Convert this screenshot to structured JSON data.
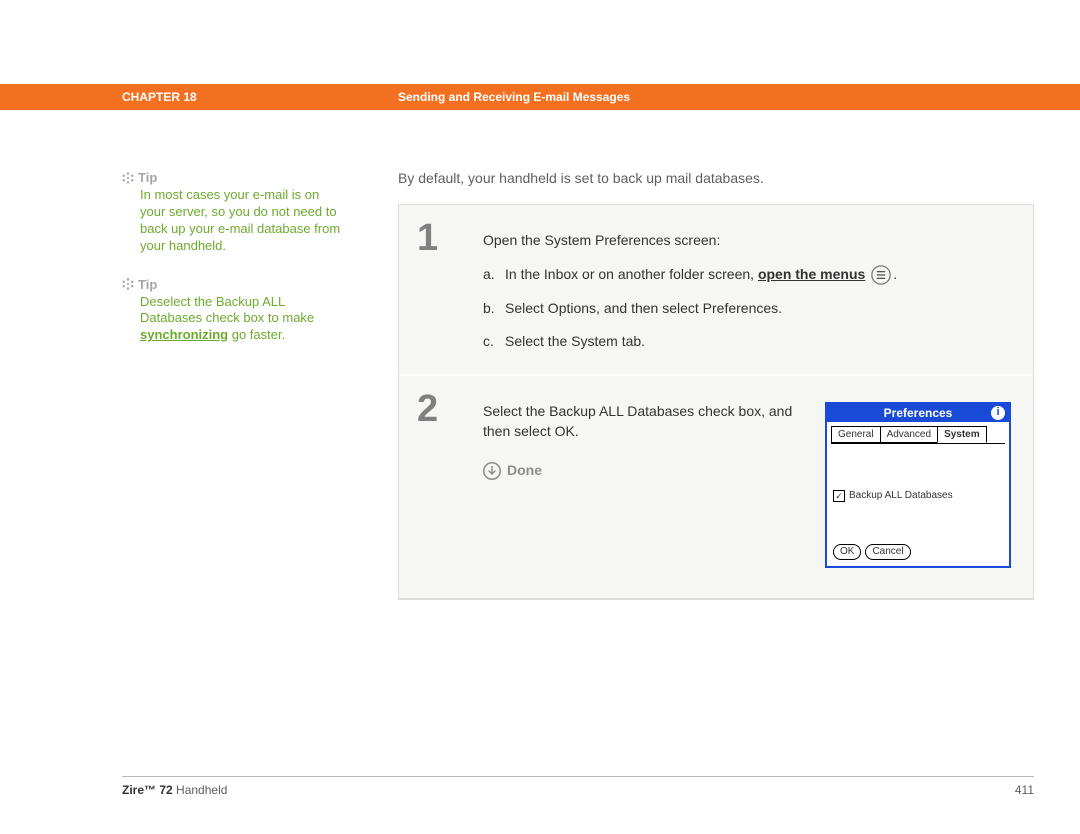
{
  "chapter": {
    "label": "CHAPTER 18",
    "title": "Sending and Receiving E-mail Messages"
  },
  "tips": [
    {
      "heading": "Tip",
      "body_pre": "In most cases your e-mail is on your server, so you do not need to back up your e-mail database from your handheld.",
      "link": "",
      "body_post": ""
    },
    {
      "heading": "Tip",
      "body_pre": "Deselect the Backup ALL Databases check box to make ",
      "link": "synchronizing",
      "body_post": " go faster."
    }
  ],
  "lead": "By default, your handheld is set to back up mail databases.",
  "steps": [
    {
      "num": "1",
      "title": "Open the System Preferences screen:",
      "subs": [
        {
          "idx": "a.",
          "pre": "In the Inbox or on another folder screen, ",
          "link": "open the menus",
          "post": " ",
          "icon": "menu-icon",
          "tail": "."
        },
        {
          "idx": "b.",
          "pre": "Select Options, and then select Preferences.",
          "link": "",
          "post": "",
          "icon": "",
          "tail": ""
        },
        {
          "idx": "c.",
          "pre": "Select the System tab.",
          "link": "",
          "post": "",
          "icon": "",
          "tail": ""
        }
      ]
    },
    {
      "num": "2",
      "text": "Select the Backup ALL Databases check box, and then select OK.",
      "done": "Done"
    }
  ],
  "device": {
    "title": "Preferences",
    "tabs": {
      "general": "General",
      "advanced": "Advanced",
      "system": "System"
    },
    "checkbox_label": "Backup ALL Databases",
    "ok": "OK",
    "cancel": "Cancel"
  },
  "footer": {
    "brand_bold": "Zire™ 72",
    "brand_rest": " Handheld",
    "page": "411"
  }
}
